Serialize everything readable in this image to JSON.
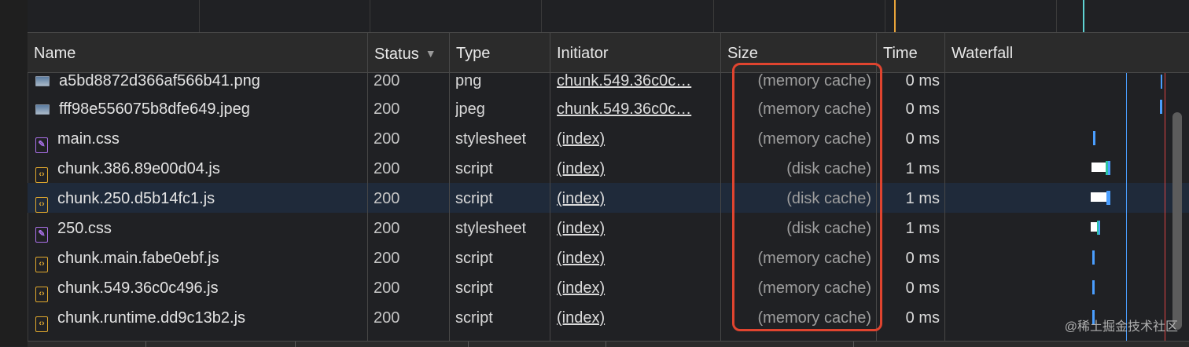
{
  "columns": {
    "name": "Name",
    "status": "Status",
    "status_sort": "▼",
    "type": "Type",
    "initiator": "Initiator",
    "size": "Size",
    "time": "Time",
    "waterfall": "Waterfall"
  },
  "rows": [
    {
      "name": "a5bd8872d366af566b41.png",
      "icon": "image-icon",
      "status": "200",
      "type": "png",
      "initiator": "chunk.549.36c0c…",
      "size": "(memory cache)",
      "time": "0 ms"
    },
    {
      "name": "fff98e556075b8dfe649.jpeg",
      "icon": "image-icon",
      "status": "200",
      "type": "jpeg",
      "initiator": "chunk.549.36c0c…",
      "size": "(memory cache)",
      "time": "0 ms"
    },
    {
      "name": "main.css",
      "icon": "stylesheet-icon",
      "status": "200",
      "type": "stylesheet",
      "initiator": "(index)",
      "size": "(memory cache)",
      "time": "0 ms"
    },
    {
      "name": "chunk.386.89e00d04.js",
      "icon": "script-icon",
      "status": "200",
      "type": "script",
      "initiator": "(index)",
      "size": "(disk cache)",
      "time": "1 ms"
    },
    {
      "name": "chunk.250.d5b14fc1.js",
      "icon": "script-icon",
      "status": "200",
      "type": "script",
      "initiator": "(index)",
      "size": "(disk cache)",
      "time": "1 ms",
      "selected": true
    },
    {
      "name": "250.css",
      "icon": "stylesheet-icon",
      "status": "200",
      "type": "stylesheet",
      "initiator": "(index)",
      "size": "(disk cache)",
      "time": "1 ms"
    },
    {
      "name": "chunk.main.fabe0ebf.js",
      "icon": "script-icon",
      "status": "200",
      "type": "script",
      "initiator": "(index)",
      "size": "(memory cache)",
      "time": "0 ms"
    },
    {
      "name": "chunk.549.36c0c496.js",
      "icon": "script-icon",
      "status": "200",
      "type": "script",
      "initiator": "(index)",
      "size": "(memory cache)",
      "time": "0 ms"
    },
    {
      "name": "chunk.runtime.dd9c13b2.js",
      "icon": "script-icon",
      "status": "200",
      "type": "script",
      "initiator": "(index)",
      "size": "(memory cache)",
      "time": "0 ms"
    }
  ],
  "watermark": "@稀土掘金技术社区",
  "colors": {
    "highlight": "#e0442f",
    "waterfall_blue": "#4a9eff",
    "waterfall_red": "#d44",
    "script_icon": "#e0a82e",
    "stylesheet_icon": "#a970e8"
  }
}
